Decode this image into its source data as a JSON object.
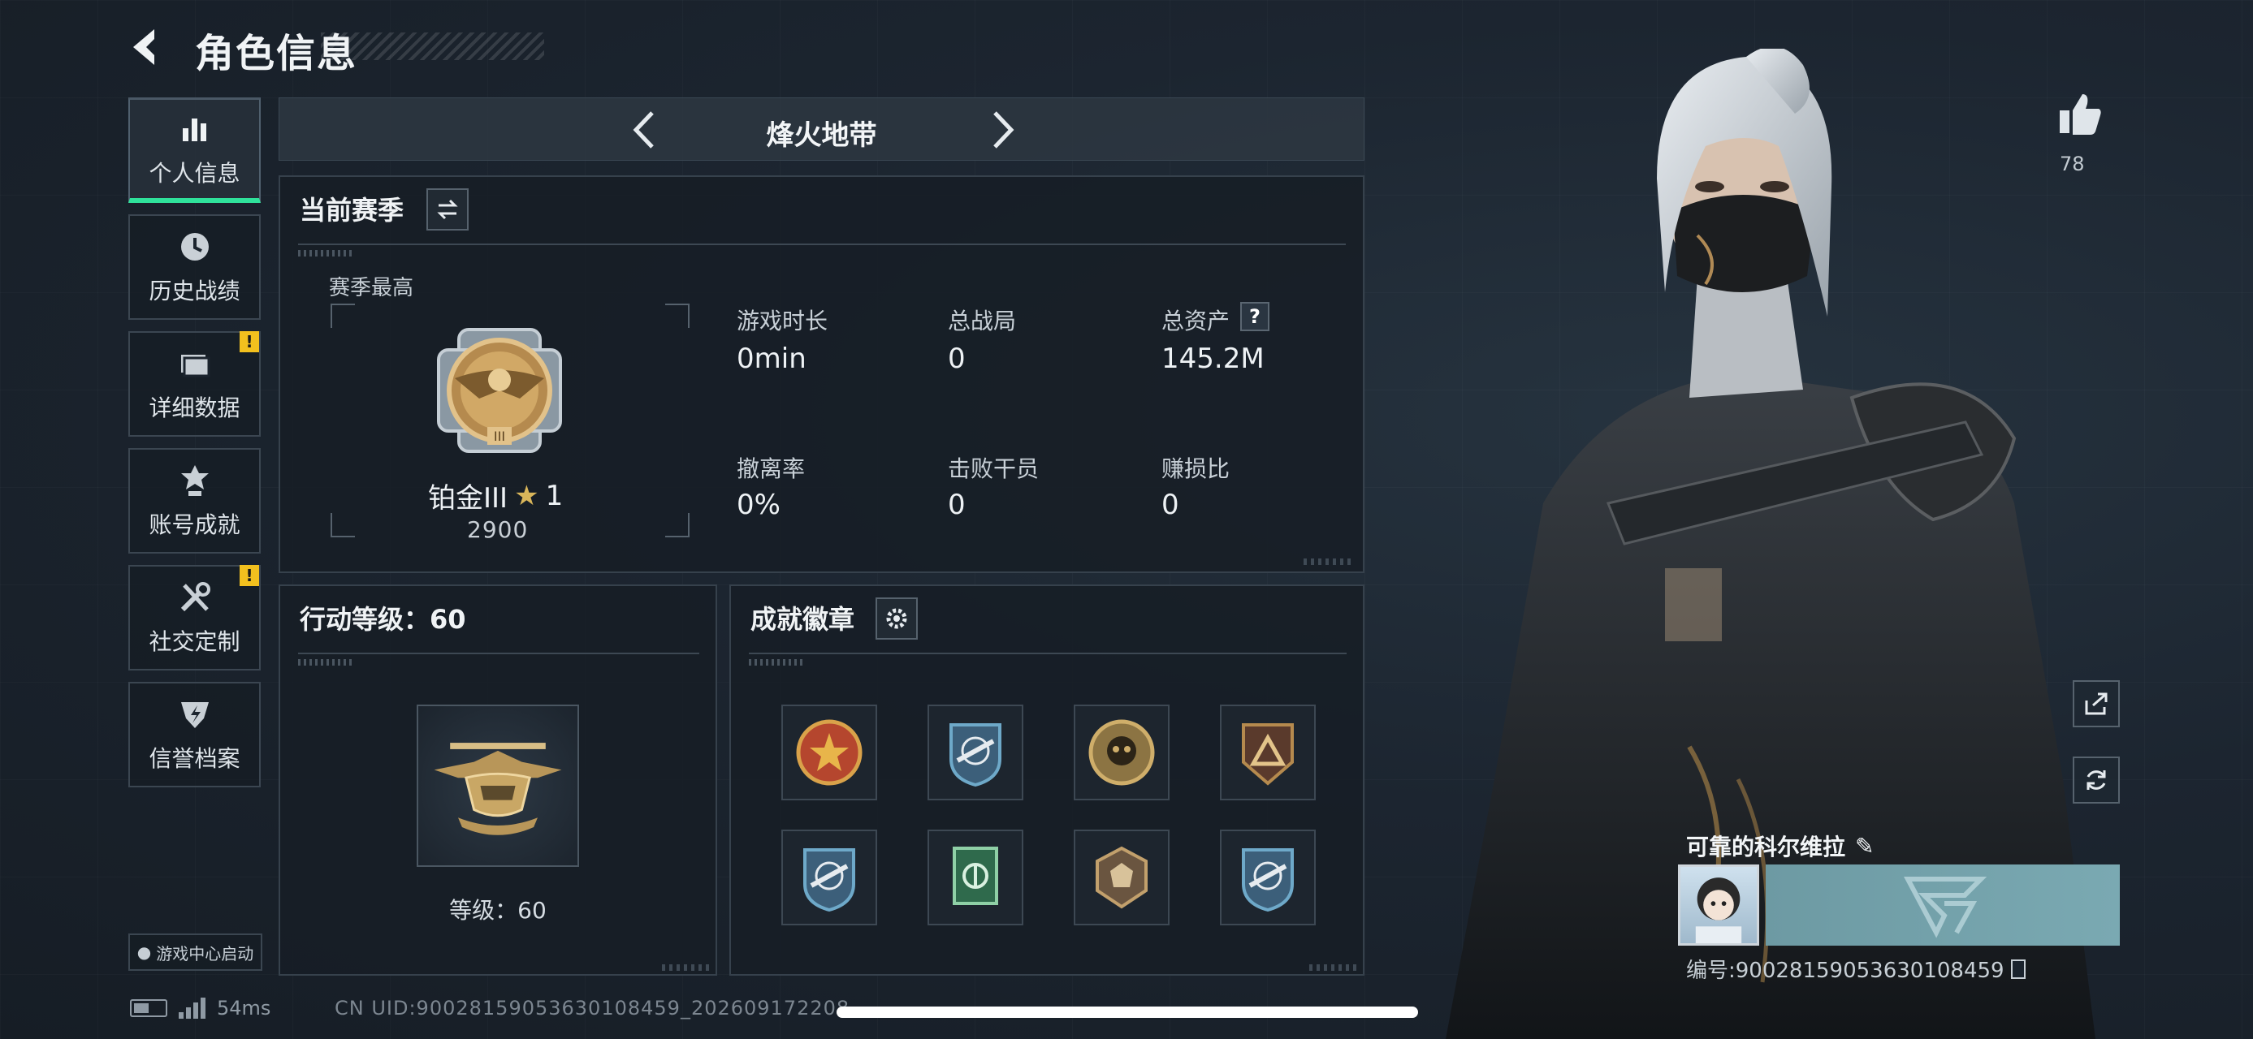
{
  "header": {
    "title": "角色信息"
  },
  "sidebar": {
    "items": [
      {
        "label": "个人信息",
        "icon": "bar-chart-icon",
        "active": true,
        "warning": false
      },
      {
        "label": "历史战绩",
        "icon": "clock-icon",
        "active": false,
        "warning": false
      },
      {
        "label": "详细数据",
        "icon": "folder-icon",
        "active": false,
        "warning": true
      },
      {
        "label": "账号成就",
        "icon": "medal-icon",
        "active": false,
        "warning": false
      },
      {
        "label": "社交定制",
        "icon": "tools-icon",
        "active": false,
        "warning": true
      },
      {
        "label": "信誉档案",
        "icon": "shield-icon",
        "active": false,
        "warning": false
      }
    ],
    "warning_mark": "!",
    "game_center": "游戏中心启动"
  },
  "mode": {
    "title": "烽火地带"
  },
  "season": {
    "heading": "当前赛季",
    "best_label": "赛季最高",
    "rank_name": "铂金III",
    "rank_stars": "1",
    "rank_score": "2900",
    "stats": [
      {
        "label": "游戏时长",
        "value": "0min"
      },
      {
        "label": "总战局",
        "value": "0"
      },
      {
        "label": "总资产",
        "value": "145.2M",
        "help": "?"
      },
      {
        "label": "撤离率",
        "value": "0%"
      },
      {
        "label": "击败干员",
        "value": "0"
      },
      {
        "label": "赚损比",
        "value": "0"
      }
    ]
  },
  "action_level": {
    "heading": "行动等级：60",
    "level_text": "等级：60"
  },
  "badges": {
    "heading": "成就徽章",
    "items": [
      "badge-1",
      "badge-2",
      "badge-3",
      "badge-4",
      "badge-5",
      "badge-6",
      "badge-7",
      "badge-8"
    ]
  },
  "profile": {
    "likes": "78",
    "name": "可靠的科尔维拉",
    "uid_text": "编号:9002815905363010845­9"
  },
  "status_bar": {
    "ping": "54ms",
    "uid_line": "CN UID:9002815905363010845­9_202609172208"
  },
  "colors": {
    "accent": "#2fe29b",
    "warning": "#f2c01e",
    "panel_border": "#36414c"
  }
}
